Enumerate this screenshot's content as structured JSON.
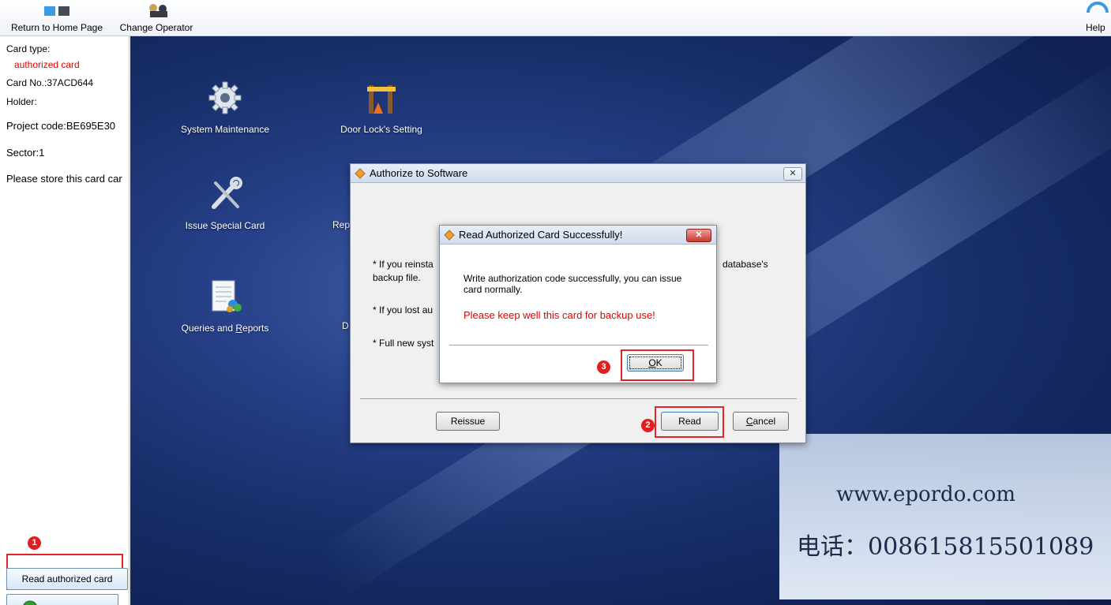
{
  "toolbar": {
    "return_home": "Return to Home Page",
    "change_operator": "Change Operator",
    "help": "Help"
  },
  "sidebar": {
    "card_type_label": "Card type:",
    "card_type_value": "authorized card",
    "card_no": "Card No.:37ACD644",
    "holder": "Holder:",
    "project_code": "Project code:BE695E30",
    "sector": "Sector:1",
    "note": "Please store this card car",
    "read_button": "Read authorized card"
  },
  "desktop": {
    "system_maintenance": "System Maintenance",
    "door_lock_setting": "Door Lock's Setting",
    "issue_special_card": "Issue Special Card",
    "queries_reports": "Queries and Reports",
    "partial_rep": "Rep",
    "partial_d": "D"
  },
  "auth_dialog": {
    "title": "Authorize to Software",
    "line1_left": "* If you reinsta",
    "line1_right": "database's",
    "line1_cont": "backup file.",
    "line2": "* If you lost au",
    "line3": "* Full new syst",
    "reissue": "Reissue",
    "read": "Read",
    "cancel": "Cancel"
  },
  "success_dialog": {
    "title": "Read Authorized Card Successfully!",
    "message": "Write authorization code successfully, you can issue card normally.",
    "warning": "Please keep well this card for backup use!",
    "ok": "OK"
  },
  "badges": [
    "1",
    "2",
    "3"
  ],
  "watermark": {
    "website": "www.epordo.com",
    "phone": "电话：008615815501089"
  },
  "colors": {
    "highlight_red": "#e0242a",
    "text_red": "#e00000"
  }
}
